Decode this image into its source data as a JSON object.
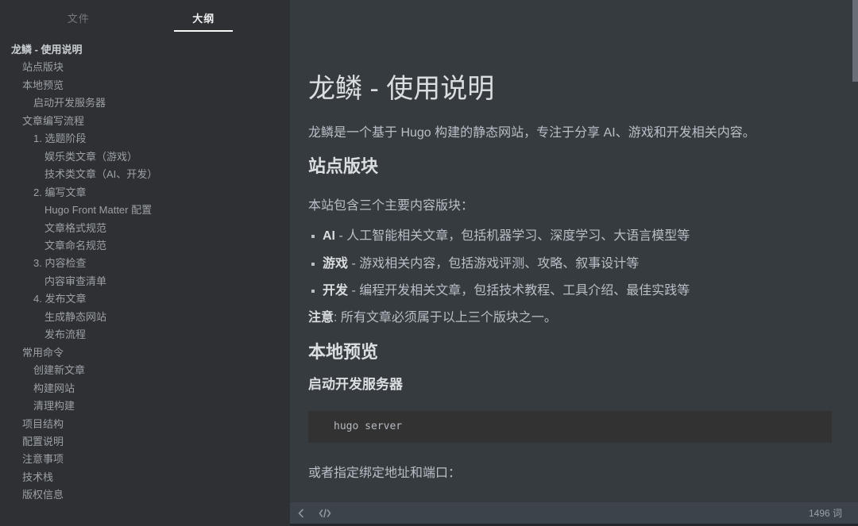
{
  "sidebar": {
    "tabs": [
      {
        "label": "文件",
        "active": false
      },
      {
        "label": "大纲",
        "active": true
      }
    ],
    "outline": [
      {
        "label": "龙鳞 - 使用说明",
        "level": 1
      },
      {
        "label": "站点版块",
        "level": 2
      },
      {
        "label": "本地预览",
        "level": 2
      },
      {
        "label": "启动开发服务器",
        "level": 3
      },
      {
        "label": "文章编写流程",
        "level": 2
      },
      {
        "label": "1. 选题阶段",
        "level": 3
      },
      {
        "label": "娱乐类文章（游戏）",
        "level": 4
      },
      {
        "label": "技术类文章（AI、开发）",
        "level": 4
      },
      {
        "label": "2. 编写文章",
        "level": 3
      },
      {
        "label": "Hugo Front Matter 配置",
        "level": 4
      },
      {
        "label": "文章格式规范",
        "level": 4
      },
      {
        "label": "文章命名规范",
        "level": 4
      },
      {
        "label": "3. 内容检查",
        "level": 3
      },
      {
        "label": "内容审查清单",
        "level": 4
      },
      {
        "label": "4. 发布文章",
        "level": 3
      },
      {
        "label": "生成静态网站",
        "level": 4
      },
      {
        "label": "发布流程",
        "level": 4
      },
      {
        "label": "常用命令",
        "level": 2
      },
      {
        "label": "创建新文章",
        "level": 3
      },
      {
        "label": "构建网站",
        "level": 3
      },
      {
        "label": "清理构建",
        "level": 3
      },
      {
        "label": "项目结构",
        "level": 2
      },
      {
        "label": "配置说明",
        "level": 2
      },
      {
        "label": "注意事项",
        "level": 2
      },
      {
        "label": "技术栈",
        "level": 2
      },
      {
        "label": "版权信息",
        "level": 2
      }
    ]
  },
  "main": {
    "title": "龙鳞 - 使用说明",
    "intro": "龙鳞是一个基于 Hugo 构建的静态网站，专注于分享 AI、游戏和开发相关内容。",
    "site_sections": {
      "heading": "站点版块",
      "lead": "本站包含三个主要内容版块：",
      "items": [
        {
          "term": "AI",
          "desc": " - 人工智能相关文章，包括机器学习、深度学习、大语言模型等"
        },
        {
          "term": "游戏",
          "desc": " - 游戏相关内容，包括游戏评测、攻略、叙事设计等"
        },
        {
          "term": "开发",
          "desc": " - 编程开发相关文章，包括技术教程、工具介绍、最佳实践等"
        }
      ],
      "note_term": "注意",
      "note_rest": ": 所有文章必须属于以上三个版块之一。"
    },
    "local_preview": {
      "heading": "本地预览",
      "subheading": "启动开发服务器",
      "code": "hugo server",
      "after": "或者指定绑定地址和端口："
    }
  },
  "footer": {
    "word_count": "1496 词",
    "icons": [
      "chevron-left-icon",
      "source-code-mode-icon"
    ]
  },
  "colors": {
    "sidebar_bg": "#2E3033",
    "content_bg": "#363B40",
    "code_block_bg": "#323232",
    "status_bar_bg": "#3C434A",
    "body_text": "#B8BFC6",
    "heading_text": "#DBDEE1",
    "outline_text": "#9CA1A7",
    "tab_active_underline": "#FAFAFA",
    "scrollbar_thumb": "#696F76"
  }
}
